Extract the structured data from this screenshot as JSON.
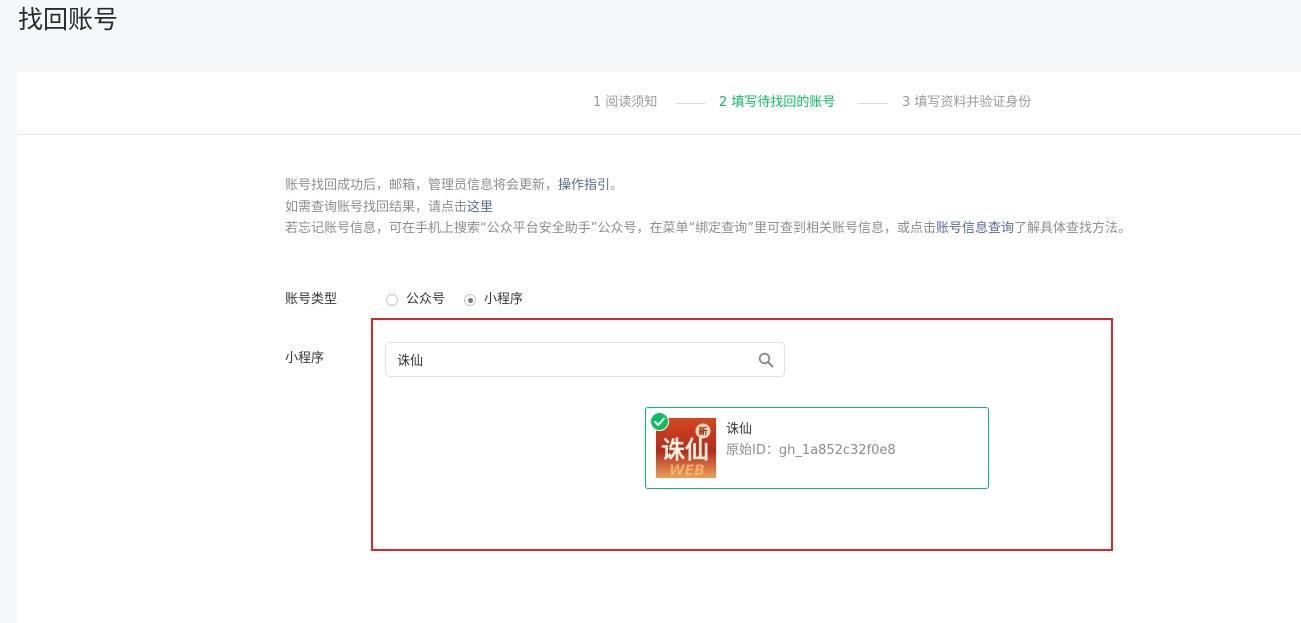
{
  "page": {
    "title": "找回账号"
  },
  "steps": [
    {
      "label": "1 阅读须知"
    },
    {
      "label": "2 填写待找回的账号"
    },
    {
      "label": "3 填写资料并验证身份"
    }
  ],
  "notice": {
    "line1_text": "账号找回成功后，邮箱，管理员信息将会更新，",
    "line1_link": "操作指引",
    "line1_end": "。",
    "line2_text": "如需查询账号找回结果，请点击",
    "line2_link": "这里",
    "line3_text": "若忘记账号信息，可在手机上搜索“公众平台安全助手”公众号，在菜单“绑定查询”里可查到相关账号信息，或点击",
    "line3_link": "账号信息查询",
    "line3_end": "了解具体查找方法。"
  },
  "form": {
    "account_type_label": "账号类型",
    "account_type_options": [
      {
        "label": "公众号",
        "checked": false
      },
      {
        "label": "小程序",
        "checked": true
      }
    ],
    "miniprogram_label": "小程序",
    "search_value": "诛仙",
    "search_icon": "search-icon"
  },
  "result": {
    "name": "诛仙",
    "id_text": "原始ID：gh_1a852c32f0e8",
    "selected": true,
    "avatar_logo_text": "诛仙",
    "avatar_badge": "新",
    "avatar_sub": "WEB"
  },
  "colors": {
    "accent": "#07c160",
    "link": "#576b95",
    "highlight_border": "#d9272e",
    "background": "#f6f7f9"
  }
}
